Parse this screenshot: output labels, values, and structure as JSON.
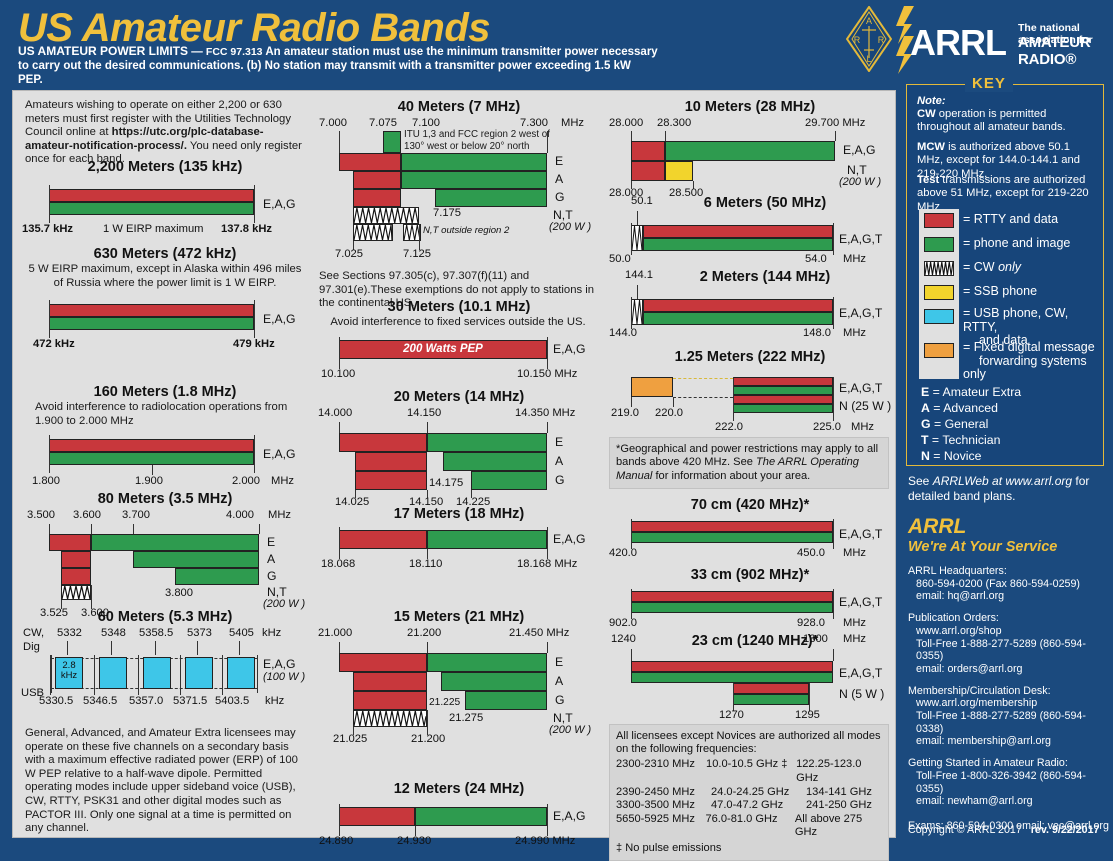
{
  "header": {
    "title": "US Amateur Radio Bands",
    "power_limits_label": "US AMATEUR POWER LIMITS",
    "power_limits_dash": "—",
    "power_limits_cite": "FCC 97.313",
    "power_limits_text1": "An amateur station must use the minimum transmitter power necessary",
    "power_limits_text2": "to carry out the desired communications.  (b) No station may transmit with a transmitter power exceeding 1.5 kW PEP.",
    "logo_word": "ARRL",
    "logo_tagline1": "The national association for",
    "logo_tagline2": "AMATEUR RADIO®",
    "diamond_letters": [
      "A",
      "R",
      "R",
      "L"
    ]
  },
  "col1": {
    "register_note": "Amateurs wishing to operate on either 2,200 or 630 meters must first register with the Utilities Technology Council online at",
    "register_url": "https://utc.org/plc-database-amateur-notification-process/.",
    "register_note2": "You need only register once for each band.",
    "b2200": {
      "title": "2,200 Meters (135 kHz)",
      "low": "135.7 kHz",
      "center": "1 W EIRP maximum",
      "high": "137.8 kHz",
      "license": "E,A,G"
    },
    "b630": {
      "title": "630 Meters (472 kHz)",
      "note": "5 W EIRP maximum, except in Alaska within 496 miles of Russia where the power limit is 1 W EIRP.",
      "low": "472 kHz",
      "high": "479 kHz",
      "license": "E,A,G"
    },
    "b160": {
      "title": "160 Meters (1.8 MHz)",
      "note": "Avoid interference to radiolocation operations from 1.900 to 2.000 MHz",
      "ticks": [
        "1.800",
        "1.900",
        "2.000"
      ],
      "unit": "MHz",
      "license": "E,A,G"
    },
    "b80": {
      "title": "80 Meters (3.5 MHz)",
      "top_ticks": [
        "3.500",
        "3.600",
        "3.700",
        "4.000"
      ],
      "top_unit": "MHz",
      "mid_tick": "3.800",
      "bottom_ticks": [
        "3.525",
        "3.600"
      ],
      "rows": [
        "E",
        "A",
        "G"
      ],
      "nt": "N,T",
      "nt_power": "(200 W )"
    },
    "b60": {
      "title": "60 Meters (5.3 MHz)",
      "left_label1": "CW,",
      "left_label2": "Dig",
      "left_label3": "USB",
      "top_ticks": [
        "5332",
        "5348",
        "5358.5",
        "5373",
        "5405"
      ],
      "top_unit": "kHz",
      "bottom_ticks": [
        "5330.5",
        "5346.5",
        "5357.0",
        "5371.5",
        "5403.5"
      ],
      "bottom_unit": "kHz",
      "channel_width1": "2.8",
      "channel_width2": "kHz",
      "license": "E,A,G",
      "power": "(100 W )",
      "note": "General, Advanced, and Amateur Extra licensees may operate on these five channels on a secondary basis with a maximum effective radiated power (ERP) of 100 W PEP relative to a half-wave dipole. Permitted operating modes include upper sideband voice (USB), CW, RTTY, PSK31 and other digital modes such as PACTOR III. Only one signal at a time is permitted on any channel."
    }
  },
  "col2": {
    "b40": {
      "title": "40 Meters (7 MHz)",
      "top_ticks": [
        "7.000",
        "7.075",
        "7.100",
        "7.300"
      ],
      "top_unit": "MHz",
      "itu_note": "ITU 1,3 and FCC region 2 west of 130° west or below 20° north",
      "mid_tick": "7.175",
      "nt_outside": "N,T outside region 2",
      "bottom_ticks": [
        "7.025",
        "7.125"
      ],
      "rows": [
        "E",
        "A",
        "G"
      ],
      "nt": "N,T",
      "nt_power": "(200 W )",
      "sections_note": "See Sections 97.305(c), 97.307(f)(11) and 97.301(e).These exemptions do not apply to stations in the continental US."
    },
    "b30": {
      "title": "30 Meters (10.1 MHz)",
      "note": "Avoid interference to fixed services outside the US.",
      "inbar_label": "200 Watts PEP",
      "low": "10.100",
      "high": "10.150 MHz",
      "license": "E,A,G"
    },
    "b20": {
      "title": "20 Meters (14 MHz)",
      "top_ticks": [
        "14.000",
        "14.150",
        "14.350 MHz"
      ],
      "mid_tick": "14.175",
      "bottom_ticks": [
        "14.025",
        "14.150",
        "14.225"
      ],
      "rows": [
        "E",
        "A",
        "G"
      ]
    },
    "b17": {
      "title": "17 Meters (18 MHz)",
      "ticks": [
        "18.068",
        "18.110",
        "18.168 MHz"
      ],
      "license": "E,A,G"
    },
    "b15": {
      "title": "15 Meters (21 MHz)",
      "top_ticks": [
        "21.000",
        "21.200",
        "21.450 MHz"
      ],
      "mid_tick1": "21.225",
      "mid_tick2": "21.275",
      "bottom_ticks": [
        "21.025",
        "21.200"
      ],
      "rows": [
        "E",
        "A",
        "G"
      ],
      "nt": "N,T",
      "nt_power": "(200 W )"
    },
    "b12": {
      "title": "12 Meters (24 MHz)",
      "ticks": [
        "24.890",
        "24.930",
        "24.990 MHz"
      ],
      "license": "E,A,G"
    }
  },
  "col3": {
    "b10": {
      "title": "10 Meters (28 MHz)",
      "top_ticks": [
        "28.000",
        "28.300",
        "29.700 MHz"
      ],
      "bottom_ticks": [
        "28.000",
        "28.500"
      ],
      "license1": "E,A,G",
      "license2": "N,T",
      "power2": "(200 W )"
    },
    "b6": {
      "title": "6 Meters (50 MHz)",
      "top_tick": "50.1",
      "low": "50.0",
      "high": "54.0",
      "unit": "MHz",
      "license": "E,A,G,T"
    },
    "b2": {
      "title": "2 Meters (144 MHz)",
      "top_tick": "144.1",
      "low": "144.0",
      "high": "148.0",
      "unit": "MHz",
      "license": "E,A,G,T"
    },
    "b125": {
      "title": "1.25 Meters (222 MHz)",
      "left_ticks": [
        "219.0",
        "220.0"
      ],
      "right_ticks": [
        "222.0",
        "225.0"
      ],
      "unit": "MHz",
      "license1": "E,A,G,T",
      "license2": "N (25 W )"
    },
    "geo_note_pre": "*Geographical and power restrictions may apply to all bands above 420 MHz. See ",
    "geo_note_italic": "The ARRL Operating Manual",
    "geo_note_post": " for information about your area.",
    "b70cm": {
      "title": "70 cm (420 MHz)*",
      "low": "420.0",
      "high": "450.0",
      "unit": "MHz",
      "license": "E,A,G,T"
    },
    "b33cm": {
      "title": "33 cm (902 MHz)*",
      "low": "902.0",
      "high": "928.0",
      "unit": "MHz",
      "license": "E,A,G,T"
    },
    "b23cm": {
      "title": "23 cm (1240 MHz)*",
      "low": "1240",
      "high": "1300",
      "unit": "MHz",
      "sub_low": "1270",
      "sub_high": "1295",
      "license1": "E,A,G,T",
      "license2": "N (5 W )"
    },
    "micro": {
      "intro1": "All licensees except Novices are authorized all modes",
      "intro2": "on the following frequencies:",
      "rows": [
        [
          "2300-2310 MHz",
          "10.0-10.5 GHz ‡",
          "122.25-123.0 GHz"
        ],
        [
          "2390-2450 MHz",
          "24.0-24.25 GHz",
          "134-141 GHz"
        ],
        [
          "3300-3500 MHz",
          "47.0-47.2 GHz",
          "241-250 GHz"
        ],
        [
          "5650-5925 MHz",
          "76.0-81.0 GHz",
          "All above 275 GHz"
        ]
      ],
      "footnote": "‡ No pulse emissions"
    }
  },
  "key": {
    "label": "KEY",
    "note_head": "Note:",
    "note_cw_bold": "CW",
    "note_cw": " operation is permitted throughout all amateur bands.",
    "note_mcw_bold": "MCW",
    "note_mcw": " is authorized above 50.1 MHz, except for 144.0-144.1 and 219-220 MHz.",
    "note_test_bold": "Test",
    "note_test": " transmissions are authorized above 51 MHz, except for 219-220 MHz",
    "swatches": [
      {
        "color": "#c8373c",
        "name": "red-swatch",
        "label": "= RTTY and data"
      },
      {
        "color": "#2e9b4f",
        "name": "green-swatch",
        "label": "= phone and image"
      },
      {
        "color": "#ffffff",
        "name": "cw-swatch",
        "label": "= CW only",
        "italic_tail": "only"
      },
      {
        "color": "#f2d42c",
        "name": "yellow-swatch",
        "label": "= SSB phone"
      },
      {
        "color": "#3ec6e8",
        "name": "cyan-swatch",
        "label": "= USB phone, CW, RTTY,",
        "label2": "and  data"
      },
      {
        "color": "#efa040",
        "name": "orange-swatch",
        "label": "= Fixed digital message",
        "label2": "forwarding systems only"
      }
    ],
    "classes": [
      {
        "letter": "E",
        "name": "Amateur Extra"
      },
      {
        "letter": "A",
        "name": "Advanced"
      },
      {
        "letter": "G",
        "name": "General"
      },
      {
        "letter": "T",
        "name": "Technician"
      },
      {
        "letter": "N",
        "name": "Novice"
      }
    ],
    "see_web_pre": "See ",
    "see_web_italic": "ARRLWeb at www.arrl.org",
    "see_web_post": " for detailed band plans."
  },
  "service": {
    "arrl": "ARRL",
    "tagline": "We're At Your Service",
    "groups": [
      {
        "head": "ARRL Headquarters:",
        "lines": [
          "860-594-0200  (Fax 860-594-0259)",
          "email:  hq@arrl.org"
        ]
      },
      {
        "head": "Publication Orders:",
        "lines": [
          "www.arrl.org/shop",
          "Toll-Free 1-888-277-5289 (860-594-0355)",
          "email: orders@arrl.org"
        ]
      },
      {
        "head": "Membership/Circulation Desk:",
        "lines": [
          "www.arrl.org/membership",
          "Toll-Free 1-888-277-5289 (860-594-0338)",
          "email: membership@arrl.org"
        ]
      },
      {
        "head": "Getting Started in Amateur Radio:",
        "lines": [
          "Toll-Free 1-800-326-3942 (860-594-0355)",
          "email: newham@arrl.org"
        ]
      }
    ],
    "exams": "Exams:  860-594-0300   email: vec@arrl.org",
    "copyright": "Copyright © ARRL 2017",
    "revision": "rev. 9/22/2017"
  },
  "colors": {
    "background": "#1b4a7e",
    "panel": "#e0e0e0",
    "gold": "#f0c03c",
    "rtty_red": "#c8373c",
    "phone_green": "#2e9b4f",
    "ssb_yellow": "#f2d42c",
    "usb_cyan": "#3ec6e8",
    "fixed_orange": "#efa040"
  }
}
